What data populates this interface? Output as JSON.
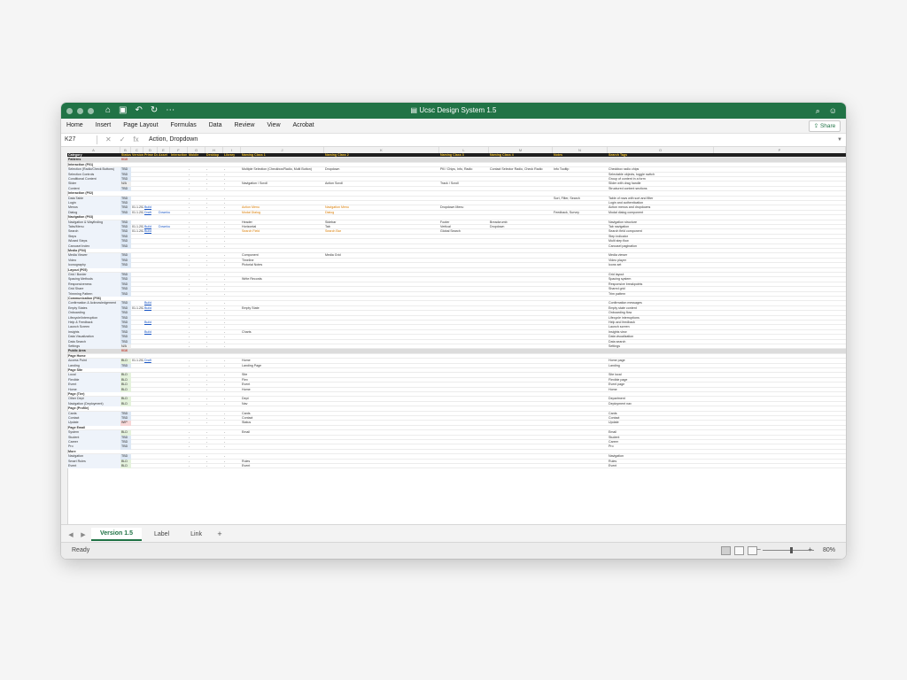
{
  "app": {
    "title": "Ucsc Design System 1.5"
  },
  "ribbon": {
    "tabs": [
      "Home",
      "Insert",
      "Page Layout",
      "Formulas",
      "Data",
      "Review",
      "View",
      "Acrobat"
    ],
    "share": "Share"
  },
  "formula_bar": {
    "cell_ref": "K27",
    "fx": "fx",
    "content": "Action, Dropdown"
  },
  "columns": [
    "A",
    "B",
    "C",
    "D",
    "E",
    "F",
    "G",
    "H",
    "I",
    "J",
    "K",
    "L",
    "M",
    "N",
    "O",
    "P",
    "Q"
  ],
  "header_row": [
    "Category",
    "Status",
    "Version",
    "Prime Doc",
    "Asset",
    "Interaction",
    "Mobile",
    "Desktop",
    "Library",
    "Naming Class 1",
    "Naming Class 2",
    "Naming Class 3",
    "Naming Class 4",
    "Notes",
    "Search Tags"
  ],
  "rows": [
    {
      "type": "sec",
      "cells": [
        "Patterns",
        "0/10"
      ]
    },
    {
      "type": "sub",
      "cells": [
        "Interaction (P01)"
      ]
    },
    {
      "type": "item",
      "cells": [
        "Selection (Radio/Check Buttons)",
        "TBD",
        "",
        "",
        "",
        "",
        "-",
        "-",
        "-",
        "Multiple Selection (Checkbox/Radio, Multi Button)",
        "Dropdown",
        "Pill / Chips, Info, Radio",
        "Contact Selector Radio, Check Radio",
        "Info Tooltip",
        "Checkbox radio chips"
      ]
    },
    {
      "type": "item",
      "cells": [
        "Selection Controls",
        "TBD",
        "",
        "",
        "",
        "",
        "-",
        "-",
        "-",
        "",
        "",
        "",
        "",
        "",
        "Selectable objects, toggle switch"
      ]
    },
    {
      "type": "item",
      "cells": [
        "Conditional Content",
        "TBD",
        "",
        "",
        "",
        "",
        "-",
        "-",
        "-",
        "",
        "",
        "",
        "",
        "",
        "Group of content in a form"
      ]
    },
    {
      "type": "item",
      "cells": [
        "Slider",
        "N/A",
        "",
        "",
        "",
        "",
        "-",
        "-",
        "-",
        "Navigation / Scroll",
        "Action Scroll",
        "Track / Scroll",
        "",
        "",
        "Slider with drag handle"
      ]
    },
    {
      "type": "item",
      "cells": [
        "Content",
        "TBD",
        "",
        "",
        "",
        "",
        "-",
        "-",
        "-",
        "",
        "",
        "",
        "",
        "",
        "Structured content sections"
      ]
    },
    {
      "type": "sub",
      "cells": [
        "Interaction (P02)"
      ]
    },
    {
      "type": "item",
      "cells": [
        "Data Table",
        "TBD",
        "",
        "",
        "",
        "",
        "-",
        "-",
        "-",
        "",
        "",
        "",
        "",
        "Sort, Filter, Search",
        "Table of rows with sort and filter"
      ]
    },
    {
      "type": "item",
      "cells": [
        "Login",
        "TBD",
        "",
        "",
        "",
        "",
        "-",
        "-",
        "-",
        "",
        "",
        "",
        "",
        "",
        "Login and authentication"
      ]
    },
    {
      "type": "item",
      "cells": [
        "Menus",
        "TBD",
        "01.1.2023",
        "Build",
        "",
        "",
        "-",
        "-",
        "-",
        "Action Menu",
        "Navigation Menu",
        "Dropdown Menu",
        "",
        "",
        "Action menus and dropdowns"
      ]
    },
    {
      "type": "item",
      "cells": [
        "Dialog",
        "TBD",
        "01.1.2023",
        "Draft",
        "Download",
        "",
        "-",
        "-",
        "-",
        "Modal Dialog",
        "Dialog",
        "",
        "",
        "Feedback, Survey",
        "Modal dialog component"
      ]
    },
    {
      "type": "sub",
      "cells": [
        "Navigation (P03)"
      ]
    },
    {
      "type": "item",
      "cells": [
        "Navigation & Wayfinding",
        "TBD",
        "",
        "",
        "",
        "",
        "-",
        "-",
        "-",
        "Header",
        "Sidebar",
        "Footer",
        "Breadcrumb",
        "",
        "Navigation structure"
      ]
    },
    {
      "type": "item",
      "cells": [
        "Tabs/Menu",
        "TBD",
        "01.1.2023",
        "Build",
        "Download",
        "",
        "-",
        "-",
        "-",
        "Horizontal",
        "Tab",
        "Vertical",
        "Dropdown",
        "",
        "Tab navigation"
      ]
    },
    {
      "type": "item",
      "cells": [
        "Search",
        "TBD",
        "01.1.2023",
        "Build",
        "",
        "",
        "-",
        "-",
        "-",
        "Search Field",
        "Search Bar",
        "Global Search",
        "",
        "",
        "Search field component"
      ]
    },
    {
      "type": "item",
      "cells": [
        "Steps",
        "TBD",
        "",
        "",
        "",
        "",
        "-",
        "-",
        "-",
        "",
        "",
        "",
        "",
        "",
        "Step indicator"
      ]
    },
    {
      "type": "item",
      "cells": [
        "Wizard Steps",
        "TBD",
        "",
        "",
        "",
        "",
        "-",
        "-",
        "-",
        "",
        "",
        "",
        "",
        "",
        "Multi step flow"
      ]
    },
    {
      "type": "item",
      "cells": [
        "Carousel Index",
        "TBD",
        "",
        "",
        "",
        "",
        "-",
        "-",
        "-",
        "",
        "",
        "",
        "",
        "",
        "Carousel pagination"
      ]
    },
    {
      "type": "sub",
      "cells": [
        "Media (P04)"
      ]
    },
    {
      "type": "item",
      "cells": [
        "Media Viewer",
        "TBD",
        "",
        "",
        "",
        "",
        "-",
        "-",
        "-",
        "Component",
        "Media Grid",
        "",
        "",
        "",
        "Media viewer"
      ]
    },
    {
      "type": "item",
      "cells": [
        "Video",
        "TBD",
        "",
        "",
        "",
        "",
        "-",
        "-",
        "-",
        "Timeline",
        "",
        "",
        "",
        "",
        "Video player"
      ]
    },
    {
      "type": "item",
      "cells": [
        "Iconography",
        "TBD",
        "",
        "",
        "",
        "",
        "-",
        "-",
        "-",
        "Pictorial Notes",
        "",
        "",
        "",
        "",
        "Icons set"
      ]
    },
    {
      "type": "sub",
      "cells": [
        "Layout (P05)"
      ]
    },
    {
      "type": "item",
      "cells": [
        "Grid / Border",
        "TBD",
        "",
        "",
        "",
        "",
        "-",
        "-",
        "-",
        "",
        "",
        "",
        "",
        "",
        "Grid layout"
      ]
    },
    {
      "type": "item",
      "cells": [
        "Spacing Methods",
        "TBD",
        "",
        "",
        "",
        "",
        "-",
        "-",
        "-",
        "Write Records",
        "",
        "",
        "",
        "",
        "Spacing system"
      ]
    },
    {
      "type": "item",
      "cells": [
        "Responsiveness",
        "TBD",
        "",
        "",
        "",
        "",
        "-",
        "-",
        "-",
        "",
        "",
        "",
        "",
        "",
        "Responsive breakpoints"
      ]
    },
    {
      "type": "item",
      "cells": [
        "Grid Share",
        "TBD",
        "",
        "",
        "",
        "",
        "-",
        "-",
        "-",
        "",
        "",
        "",
        "",
        "",
        "Shared grid"
      ]
    },
    {
      "type": "item",
      "cells": [
        "Trimming Pattern",
        "TBD",
        "",
        "",
        "",
        "",
        "-",
        "-",
        "-",
        "",
        "",
        "",
        "",
        "",
        "Trim pattern"
      ]
    },
    {
      "type": "sub",
      "cells": [
        "Communication (P06)"
      ]
    },
    {
      "type": "item",
      "cells": [
        "Confirmation & Acknowledgement",
        "TBD",
        "",
        "Build",
        "",
        "",
        "-",
        "-",
        "-",
        "",
        "",
        "",
        "",
        "",
        "Confirmation messages"
      ]
    },
    {
      "type": "item",
      "cells": [
        "Empty States",
        "TBD",
        "01.1.2023",
        "Build",
        "",
        "",
        "-",
        "-",
        "-",
        "Empty State",
        "",
        "",
        "",
        "",
        "Empty state content"
      ]
    },
    {
      "type": "item",
      "cells": [
        "Onboarding",
        "TBD",
        "",
        "",
        "",
        "",
        "-",
        "-",
        "-",
        "",
        "",
        "",
        "",
        "",
        "Onboarding flow"
      ]
    },
    {
      "type": "item",
      "cells": [
        "Lifecycle/Interruption",
        "TBD",
        "",
        "",
        "",
        "",
        "-",
        "-",
        "-",
        "",
        "",
        "",
        "",
        "",
        "Lifecycle interruptions"
      ]
    },
    {
      "type": "item",
      "cells": [
        "Help & Feedback",
        "TBD",
        "",
        "Build",
        "",
        "",
        "-",
        "-",
        "-",
        "",
        "",
        "",
        "",
        "",
        "Help and feedback"
      ]
    },
    {
      "type": "item",
      "cells": [
        "Launch Screen",
        "TBD",
        "",
        "",
        "",
        "",
        "-",
        "-",
        "-",
        "",
        "",
        "",
        "",
        "",
        "Launch screen"
      ]
    },
    {
      "type": "item",
      "cells": [
        "Insights",
        "TBD",
        "",
        "Build",
        "",
        "",
        "-",
        "-",
        "-",
        "Charts",
        "",
        "",
        "",
        "",
        "Insights view"
      ]
    },
    {
      "type": "item",
      "cells": [
        "Data Visualization",
        "TBD",
        "",
        "",
        "",
        "",
        "-",
        "-",
        "-",
        "",
        "",
        "",
        "",
        "",
        "Data visualization"
      ]
    },
    {
      "type": "item",
      "cells": [
        "Data Search",
        "TBD",
        "",
        "",
        "",
        "",
        "-",
        "-",
        "-",
        "",
        "",
        "",
        "",
        "",
        "Data search"
      ]
    },
    {
      "type": "item",
      "cells": [
        "Settings",
        "N/A",
        "",
        "",
        "",
        "",
        "-",
        "-",
        "-",
        "",
        "",
        "",
        "",
        "",
        "Settings"
      ]
    },
    {
      "type": "sec",
      "cells": [
        "Public Area",
        "0/16"
      ]
    },
    {
      "type": "sub",
      "cells": [
        "Page Home"
      ]
    },
    {
      "type": "item",
      "cells": [
        "Access Point",
        "BLD",
        "01.1.2023",
        "Draft",
        "",
        "",
        "-",
        "-",
        "-",
        "Home",
        "",
        "",
        "",
        "",
        "Home page"
      ]
    },
    {
      "type": "item",
      "cells": [
        "Landing",
        "TBD",
        "",
        "",
        "",
        "",
        "-",
        "-",
        "-",
        "Landing Page",
        "",
        "",
        "",
        "",
        "Landing"
      ]
    },
    {
      "type": "sub",
      "cells": [
        "Page Site"
      ]
    },
    {
      "type": "item",
      "cells": [
        "Local",
        "BLD",
        "",
        "",
        "",
        "",
        "-",
        "-",
        "-",
        "Site",
        "",
        "",
        "",
        "",
        "Site local"
      ]
    },
    {
      "type": "item",
      "cells": [
        "Flexible",
        "BLD",
        "",
        "",
        "",
        "",
        "-",
        "-",
        "-",
        "Flex",
        "",
        "",
        "",
        "",
        "Flexible page"
      ]
    },
    {
      "type": "item",
      "cells": [
        "Event",
        "BLD",
        "",
        "",
        "",
        "",
        "-",
        "-",
        "-",
        "Event",
        "",
        "",
        "",
        "",
        "Event page"
      ]
    },
    {
      "type": "item",
      "cells": [
        "Home",
        "BLD",
        "",
        "",
        "",
        "",
        "-",
        "-",
        "-",
        "Home",
        "",
        "",
        "",
        "",
        "Home"
      ]
    },
    {
      "type": "sub",
      "cells": [
        "Page (Tier)"
      ]
    },
    {
      "type": "item",
      "cells": [
        "Other Dept",
        "BLD",
        "",
        "",
        "",
        "",
        "-",
        "-",
        "-",
        "Dept",
        "",
        "",
        "",
        "",
        "Department"
      ]
    },
    {
      "type": "item",
      "cells": [
        "Navigation (Deployment)",
        "BLD",
        "",
        "",
        "",
        "",
        "-",
        "-",
        "-",
        "Nav",
        "",
        "",
        "",
        "",
        "Deployment nav"
      ]
    },
    {
      "type": "sub",
      "cells": [
        "Page (Profile)"
      ]
    },
    {
      "type": "item",
      "cells": [
        "Cards",
        "TBD",
        "",
        "",
        "",
        "",
        "-",
        "-",
        "-",
        "Cards",
        "",
        "",
        "",
        "",
        "Cards"
      ]
    },
    {
      "type": "item",
      "cells": [
        "Contact",
        "TBD",
        "",
        "",
        "",
        "",
        "-",
        "-",
        "-",
        "Contact",
        "",
        "",
        "",
        "",
        "Contact"
      ]
    },
    {
      "type": "item",
      "cells": [
        "Update",
        "WIP",
        "",
        "",
        "",
        "",
        "-",
        "-",
        "-",
        "Status",
        "",
        "",
        "",
        "",
        "Update"
      ]
    },
    {
      "type": "sub",
      "cells": [
        "Page Email"
      ]
    },
    {
      "type": "item",
      "cells": [
        "System",
        "BLD",
        "",
        "",
        "",
        "",
        "-",
        "-",
        "-",
        "Email",
        "",
        "",
        "",
        "",
        "Email"
      ]
    },
    {
      "type": "item",
      "cells": [
        "Student",
        "TBD",
        "",
        "",
        "",
        "",
        "-",
        "-",
        "-",
        "",
        "",
        "",
        "",
        "",
        "Student"
      ]
    },
    {
      "type": "item",
      "cells": [
        "Career",
        "TBD",
        "",
        "",
        "",
        "",
        "-",
        "-",
        "-",
        "",
        "",
        "",
        "",
        "",
        "Career"
      ]
    },
    {
      "type": "item",
      "cells": [
        "Pro",
        "TBD",
        "",
        "",
        "",
        "",
        "-",
        "-",
        "-",
        "",
        "",
        "",
        "",
        "",
        "Pro"
      ]
    },
    {
      "type": "sub",
      "cells": [
        "More"
      ]
    },
    {
      "type": "item",
      "cells": [
        "Navigation",
        "TBD",
        "",
        "",
        "",
        "",
        "-",
        "-",
        "-",
        "",
        "",
        "",
        "",
        "",
        "Navigation"
      ]
    },
    {
      "type": "item",
      "cells": [
        "Smart Rules",
        "BLD",
        "",
        "",
        "",
        "",
        "-",
        "-",
        "-",
        "Rules",
        "",
        "",
        "",
        "",
        "Rules"
      ]
    },
    {
      "type": "item",
      "cells": [
        "Event",
        "BLD",
        "",
        "",
        "",
        "",
        "-",
        "-",
        "-",
        "Event",
        "",
        "",
        "",
        "",
        "Event"
      ]
    }
  ],
  "sheets": {
    "tabs": [
      "Version 1.5",
      "Label",
      "Link"
    ],
    "add": "+"
  },
  "status": {
    "ready": "Ready",
    "zoom": "80%"
  },
  "colors": {
    "accent": "#217346"
  }
}
